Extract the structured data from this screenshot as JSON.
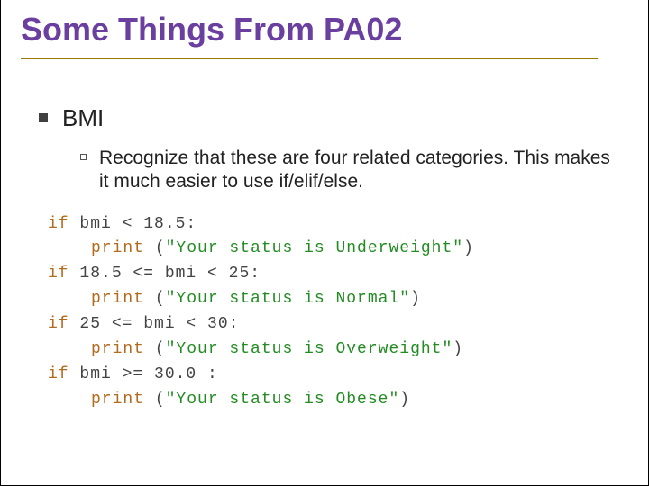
{
  "title": "Some Things From PA02",
  "bullets": {
    "l1": "BMI",
    "l2": "Recognize that these are four related categories.  This makes it much easier to use if/elif/else."
  },
  "code": {
    "lines": [
      {
        "kw": "if",
        "cond": " bmi < 18.5:"
      },
      {
        "kw": "print",
        "pre": " (",
        "str": "\"Your status is Underweight\"",
        "post": ")"
      },
      {
        "kw": "if",
        "cond": " 18.5 <= bmi < 25:"
      },
      {
        "kw": "print",
        "pre": " (",
        "str": "\"Your status is Normal\"",
        "post": ")"
      },
      {
        "kw": "if",
        "cond": " 25 <= bmi < 30:"
      },
      {
        "kw": "print",
        "pre": " (",
        "str": "\"Your status is Overweight\"",
        "post": ")"
      },
      {
        "kw": "if",
        "cond": " bmi >= 30.0 :"
      },
      {
        "kw": "print",
        "pre": " (",
        "str": "\"Your status is Obese\"",
        "post": ")"
      }
    ]
  }
}
